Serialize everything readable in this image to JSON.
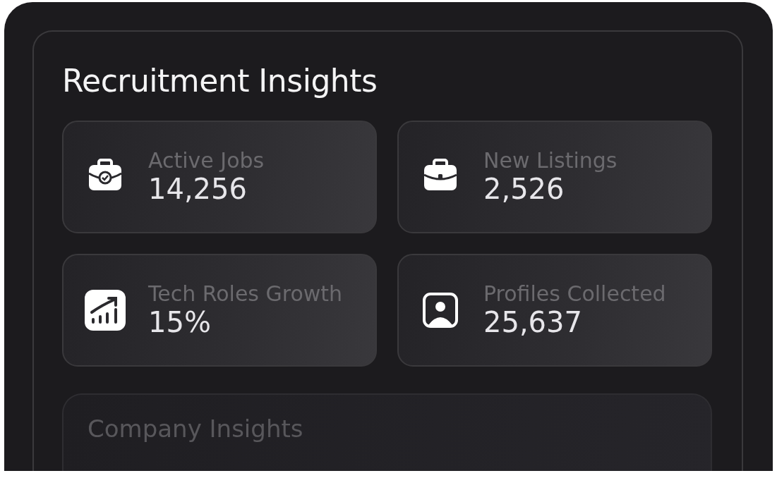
{
  "title": "Recruitment Insights",
  "stats": [
    {
      "kind": "briefcase-check",
      "label": "Active Jobs",
      "value": "14,256"
    },
    {
      "kind": "briefcase",
      "label": "New Listings",
      "value": "2,526"
    },
    {
      "kind": "chart",
      "label": "Tech Roles Growth",
      "value": "15%"
    },
    {
      "kind": "profile",
      "label": "Profiles Collected",
      "value": "25,637"
    }
  ],
  "company_card": {
    "title": "Company Insights"
  }
}
